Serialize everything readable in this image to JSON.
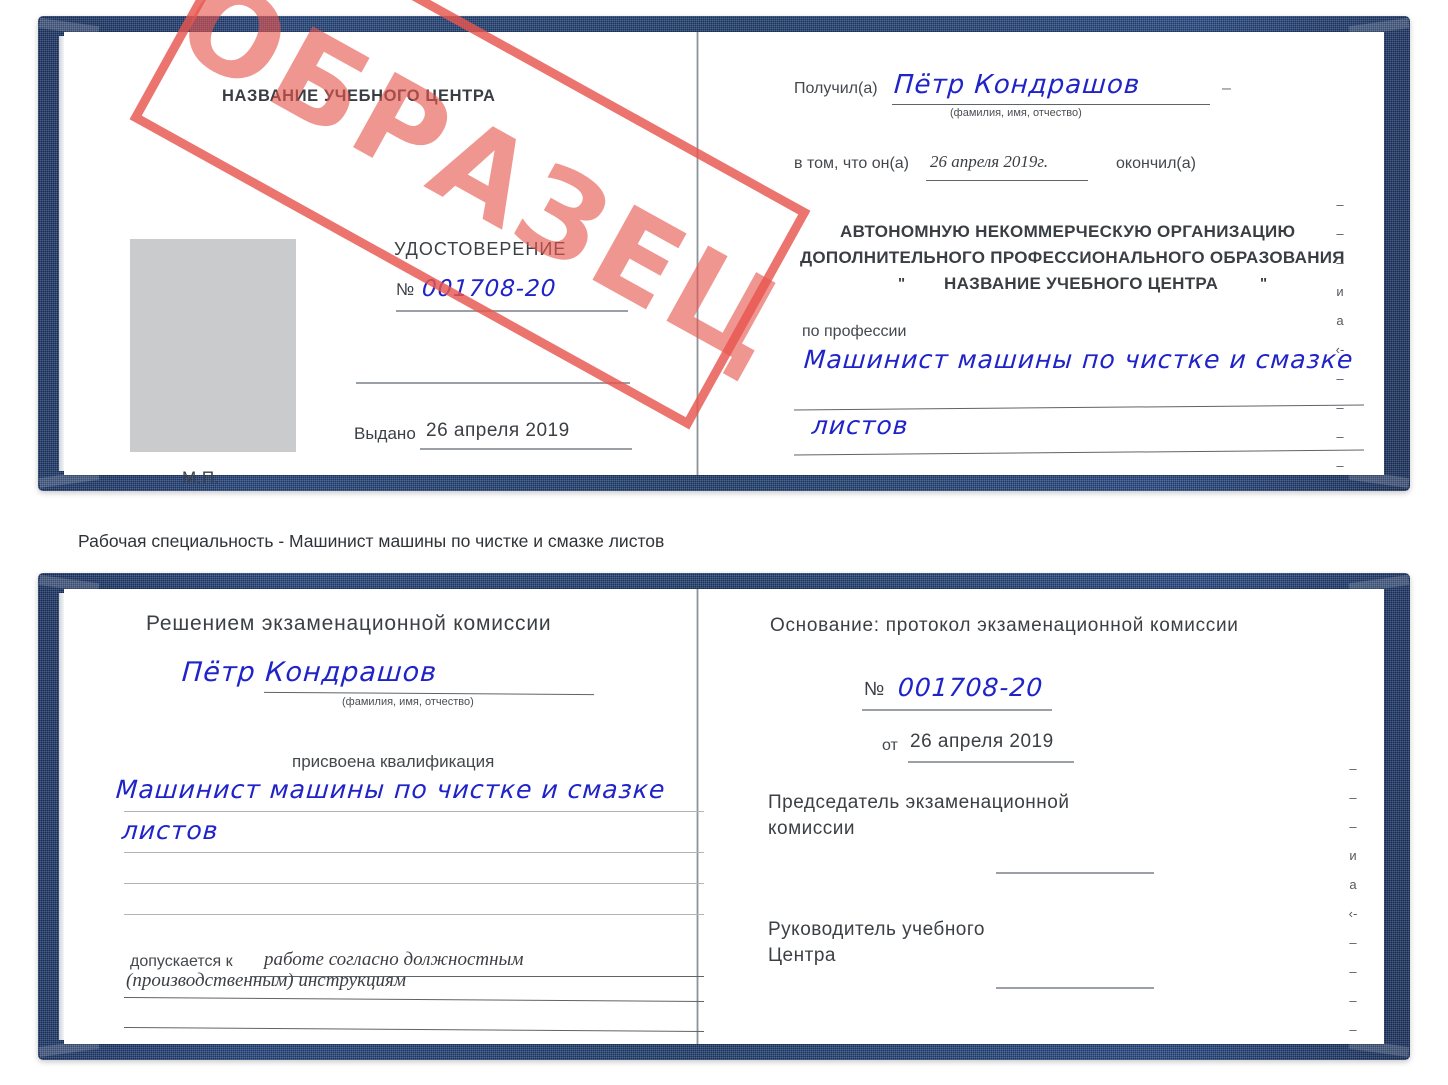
{
  "caption": "Рабочая специальность - Машинист машины по чистке и смазке листов",
  "stamp": {
    "text": "ОБРАЗЕЦ",
    "color": "#e8564e"
  },
  "colors": {
    "cover_blue": "#21406f",
    "ink_blue": "#1f23c8",
    "paper_white": "#ffffff",
    "photo_gray": "#c9cbcd",
    "text_gray": "#3c4045",
    "rule_gray": "#9aa0a6"
  },
  "certificate_top": {
    "left_page": {
      "center_name": "НАЗВАНИЕ УЧЕБНОГО ЦЕНТРА",
      "doc_title": "УДОСТОВЕРЕНИЕ",
      "number_label": "№",
      "number_value": "001708-20",
      "issued_label": "Выдано",
      "issued_value": "26 апреля 2019",
      "seal_label": "М.П.",
      "photo_placeholder": "photo-placeholder"
    },
    "right_page": {
      "received_label": "Получил(а)",
      "received_value": "Пётр Кондрашов",
      "fio_hint": "(фамилия, имя, отчество)",
      "that_he_label": "в том, что он(а)",
      "date_value": "26 апреля 2019г.",
      "finished_label": "окончил(а)",
      "org_line1": "АВТОНОМНУЮ НЕКОММЕРЧЕСКУЮ ОРГАНИЗАЦИЮ",
      "org_line2": "ДОПОЛНИТЕЛЬНОГО ПРОФЕССИОНАЛЬНОГО ОБРАЗОВАНИЯ",
      "org_quote_open": "\"",
      "org_line3": "НАЗВАНИЕ УЧЕБНОГО ЦЕНТРА",
      "org_quote_close": "\"",
      "profession_label": "по профессии",
      "profession_value_line1": "Машинист машины по чистке и смазке",
      "profession_value_line2": "листов",
      "edge_glyphs": "–\n–\n–\nи\nа\n‹-\n–\n–\n–\n–"
    }
  },
  "certificate_bottom": {
    "left_page": {
      "heading": "Решением экзаменационной комиссии",
      "name_value": "Пётр Кондрашов",
      "fio_hint": "(фамилия, имя, отчество)",
      "qualification_label": "присвоена квалификация",
      "qualification_line1": "Машинист машины по чистке и смазке",
      "qualification_line2": "листов",
      "admitted_label": "допускается к",
      "admitted_value_line1": "работе согласно должностным",
      "admitted_value_line2": "(производственным) инструкциям"
    },
    "right_page": {
      "basis_label": "Основание: протокол экзаменационной комиссии",
      "number_label": "№",
      "number_value": "001708-20",
      "from_label": "от",
      "from_value": "26 апреля 2019",
      "chairman_line1": "Председатель экзаменационной",
      "chairman_line2": "комиссии",
      "head_line1": "Руководитель учебного",
      "head_line2": "Центра",
      "edge_glyphs": "–\n–\n–\nи\nа\n‹-\n–\n–\n–\n–"
    }
  }
}
